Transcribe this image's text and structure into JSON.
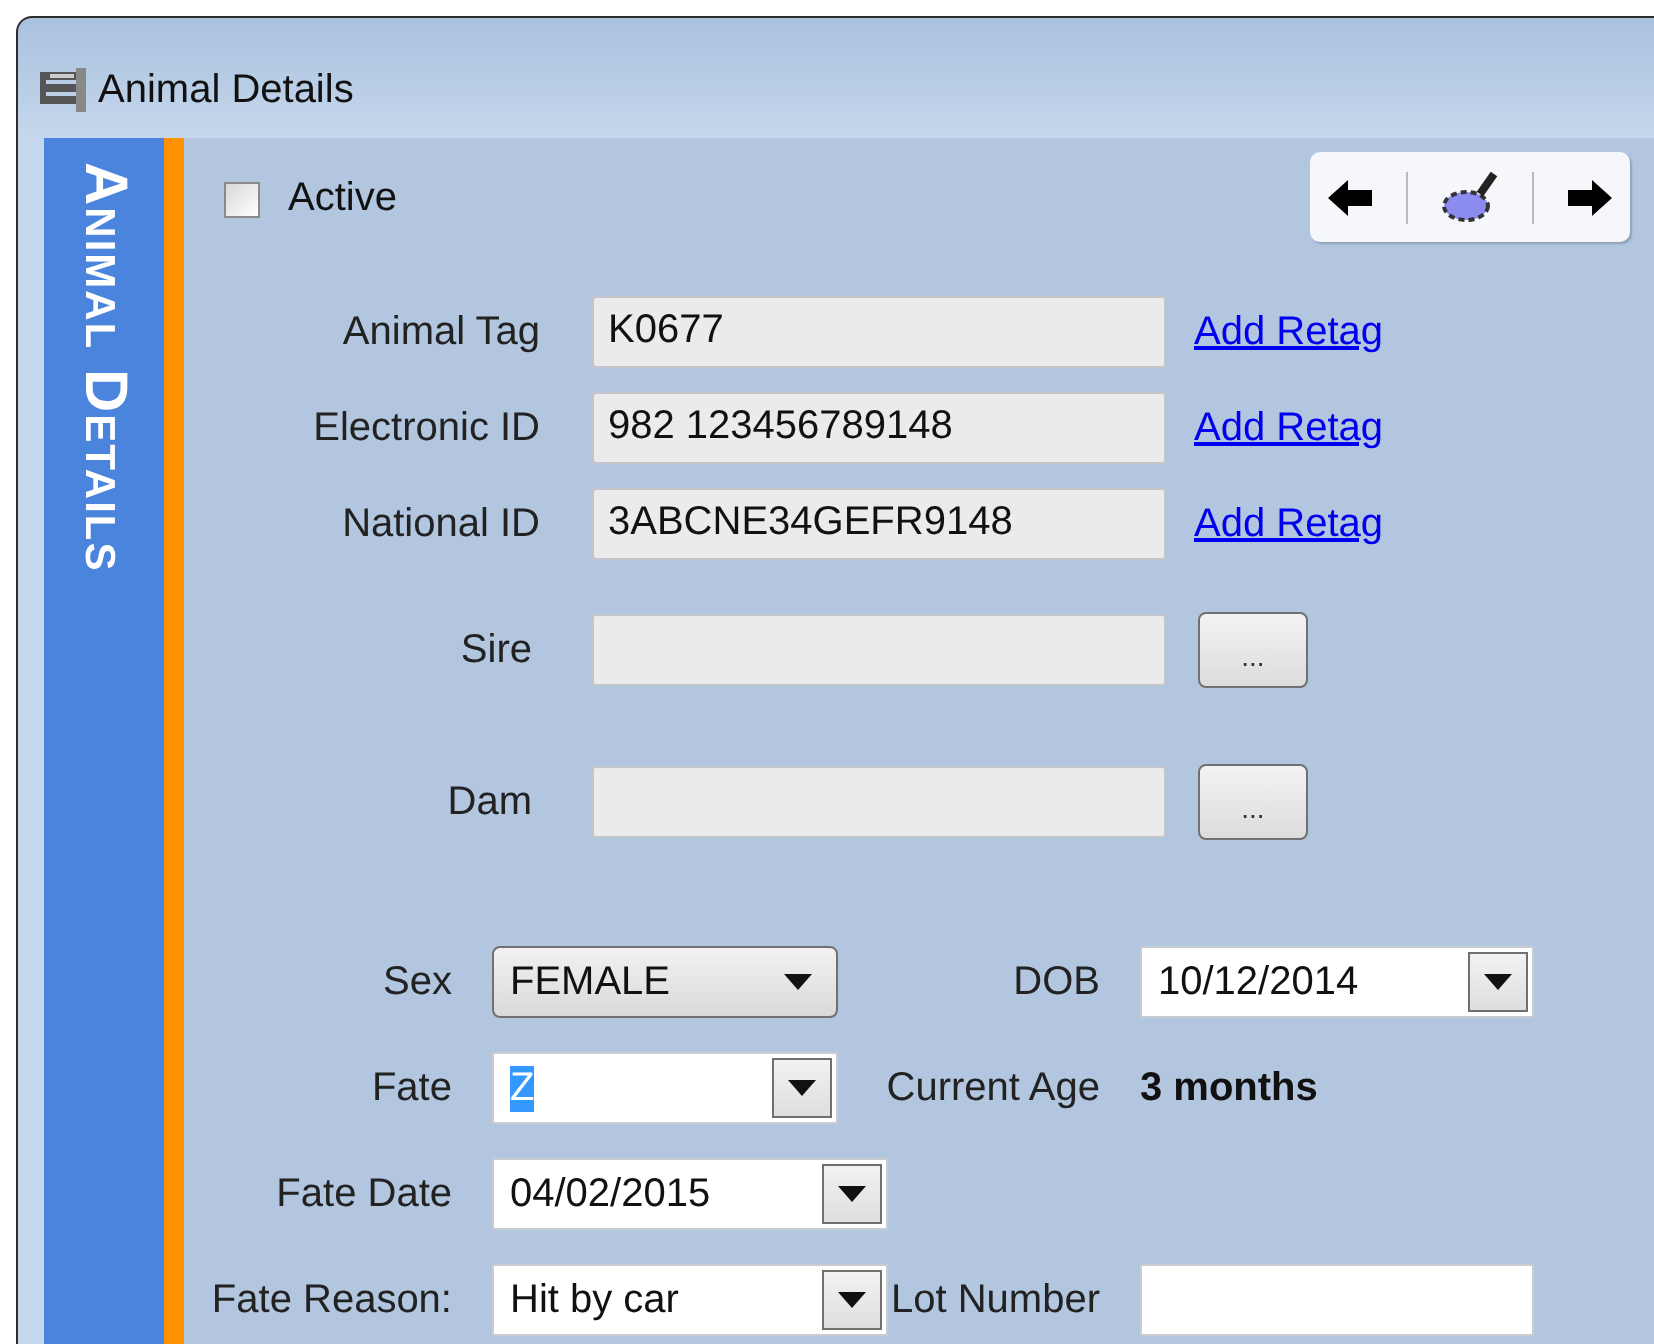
{
  "window": {
    "title": "Animal Details"
  },
  "side_label": "Animal Details",
  "active": {
    "label": "Active",
    "checked": false
  },
  "identifiers": [
    {
      "label": "Animal Tag",
      "value": "K0677",
      "link": "Add Retag"
    },
    {
      "label": "Electronic ID",
      "value": "982 123456789148",
      "link": "Add Retag"
    },
    {
      "label": "National ID",
      "value": "3ABCNE34GEFR9148",
      "link": "Add Retag"
    }
  ],
  "parents": [
    {
      "label": "Sire",
      "button": "..."
    },
    {
      "label": "Dam",
      "button": "..."
    }
  ],
  "details": [
    {
      "cells": [
        {
          "label": "Sex",
          "kind": "combo",
          "value": "FEMALE"
        },
        {
          "label": "DOB",
          "kind": "dropdown",
          "value": "10/12/2014"
        }
      ]
    },
    {
      "cells": [
        {
          "label": "Fate",
          "kind": "dropdown",
          "value": "Z",
          "highlighted": true
        },
        {
          "label": "Current Age",
          "kind": "reading",
          "value": "3 months"
        }
      ]
    },
    {
      "cells": [
        {
          "label": "Fate Date",
          "kind": "dropdown",
          "value": "04/02/2015"
        }
      ]
    },
    {
      "cells": [
        {
          "label": "Fate Reason:",
          "kind": "dropdown",
          "value": "Hit by car"
        },
        {
          "label": "Lot Number",
          "kind": "text"
        }
      ]
    }
  ]
}
